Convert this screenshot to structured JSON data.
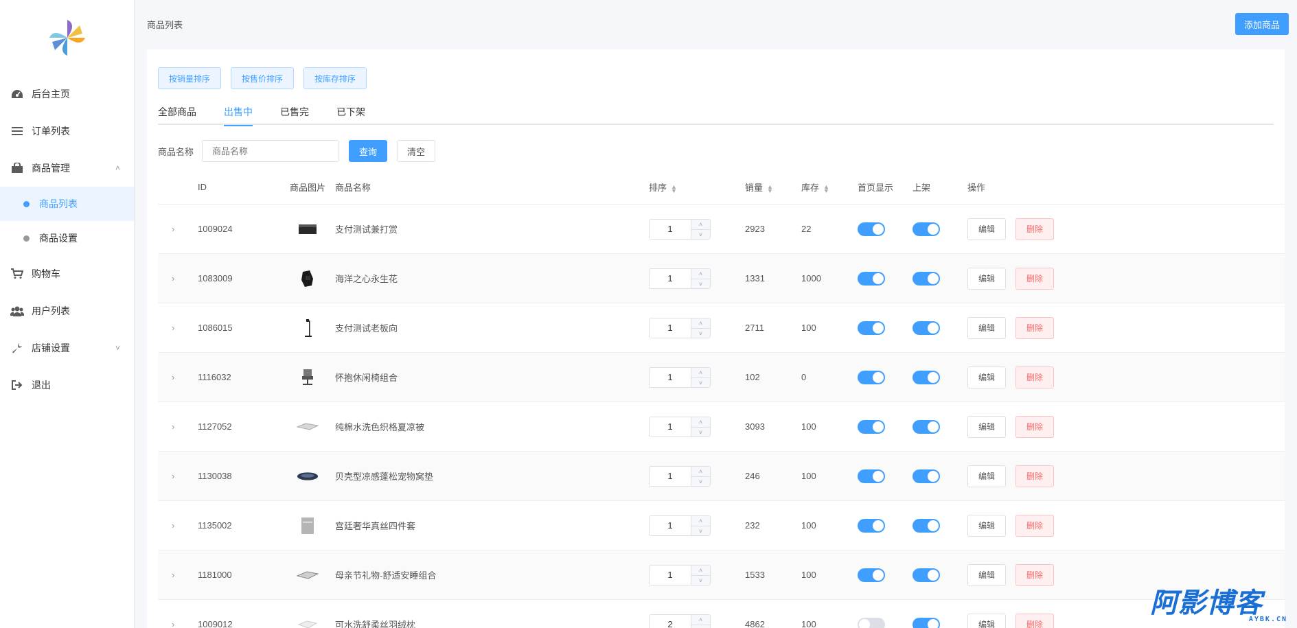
{
  "sidebar": {
    "items": [
      {
        "label": "后台主页",
        "icon": "dashboard-icon"
      },
      {
        "label": "订单列表",
        "icon": "list-icon"
      },
      {
        "label": "商品管理",
        "icon": "shopping-bag-icon",
        "expanded": true
      },
      {
        "label": "购物车",
        "icon": "cart-icon"
      },
      {
        "label": "用户列表",
        "icon": "users-icon"
      },
      {
        "label": "店铺设置",
        "icon": "wrench-icon",
        "expanded": false
      },
      {
        "label": "退出",
        "icon": "sign-out-icon"
      }
    ],
    "sub_items": [
      {
        "label": "商品列表",
        "active": true
      },
      {
        "label": "商品设置",
        "active": false
      }
    ]
  },
  "header": {
    "breadcrumb": "商品列表",
    "add_label": "添加商品"
  },
  "sort_buttons": [
    "按销量排序",
    "按售价排序",
    "按库存排序"
  ],
  "tabs": [
    {
      "label": "全部商品",
      "active": false
    },
    {
      "label": "出售中",
      "active": true
    },
    {
      "label": "已售完",
      "active": false
    },
    {
      "label": "已下架",
      "active": false
    }
  ],
  "search": {
    "label": "商品名称",
    "placeholder": "商品名称",
    "query_label": "查询",
    "clear_label": "清空"
  },
  "table": {
    "columns": {
      "id": "ID",
      "image": "商品图片",
      "name": "商品名称",
      "sort": "排序",
      "sales": "销量",
      "stock": "库存",
      "home": "首页显示",
      "on_shelf": "上架",
      "ops": "操作"
    },
    "edit_label": "编辑",
    "delete_label": "删除",
    "rows": [
      {
        "id": "1009024",
        "name": "支付测试兼打赏",
        "sort": "1",
        "sales": "2923",
        "stock": "22",
        "home": true,
        "on_shelf": true,
        "thumb": "box"
      },
      {
        "id": "1083009",
        "name": "海洋之心永生花",
        "sort": "1",
        "sales": "1331",
        "stock": "1000",
        "home": true,
        "on_shelf": true,
        "thumb": "flower"
      },
      {
        "id": "1086015",
        "name": "支付测试老板向",
        "sort": "1",
        "sales": "2711",
        "stock": "100",
        "home": true,
        "on_shelf": true,
        "thumb": "lamp"
      },
      {
        "id": "1116032",
        "name": "怀抱休闲椅组合",
        "sort": "1",
        "sales": "102",
        "stock": "0",
        "home": true,
        "on_shelf": true,
        "thumb": "chair"
      },
      {
        "id": "1127052",
        "name": "纯棉水洗色织格夏凉被",
        "sort": "1",
        "sales": "3093",
        "stock": "100",
        "home": true,
        "on_shelf": true,
        "thumb": "quilt"
      },
      {
        "id": "1130038",
        "name": "贝壳型凉感蓬松宠物窝垫",
        "sort": "1",
        "sales": "246",
        "stock": "100",
        "home": true,
        "on_shelf": true,
        "thumb": "petbed"
      },
      {
        "id": "1135002",
        "name": "宫廷奢华真丝四件套",
        "sort": "1",
        "sales": "232",
        "stock": "100",
        "home": true,
        "on_shelf": true,
        "thumb": "bedding"
      },
      {
        "id": "1181000",
        "name": "母亲节礼物-舒适安睡组合",
        "sort": "1",
        "sales": "1533",
        "stock": "100",
        "home": true,
        "on_shelf": true,
        "thumb": "mattress"
      },
      {
        "id": "1009012",
        "name": "可水洗舒柔丝羽绒枕",
        "sort": "2",
        "sales": "4862",
        "stock": "100",
        "home": false,
        "on_shelf": true,
        "thumb": "pillow"
      }
    ]
  },
  "watermark": {
    "text": "阿影博客",
    "sub": "AYBK.CN"
  },
  "colors": {
    "primary": "#409eff",
    "danger": "#f56c6c",
    "watermark": "#1a6fd4"
  }
}
